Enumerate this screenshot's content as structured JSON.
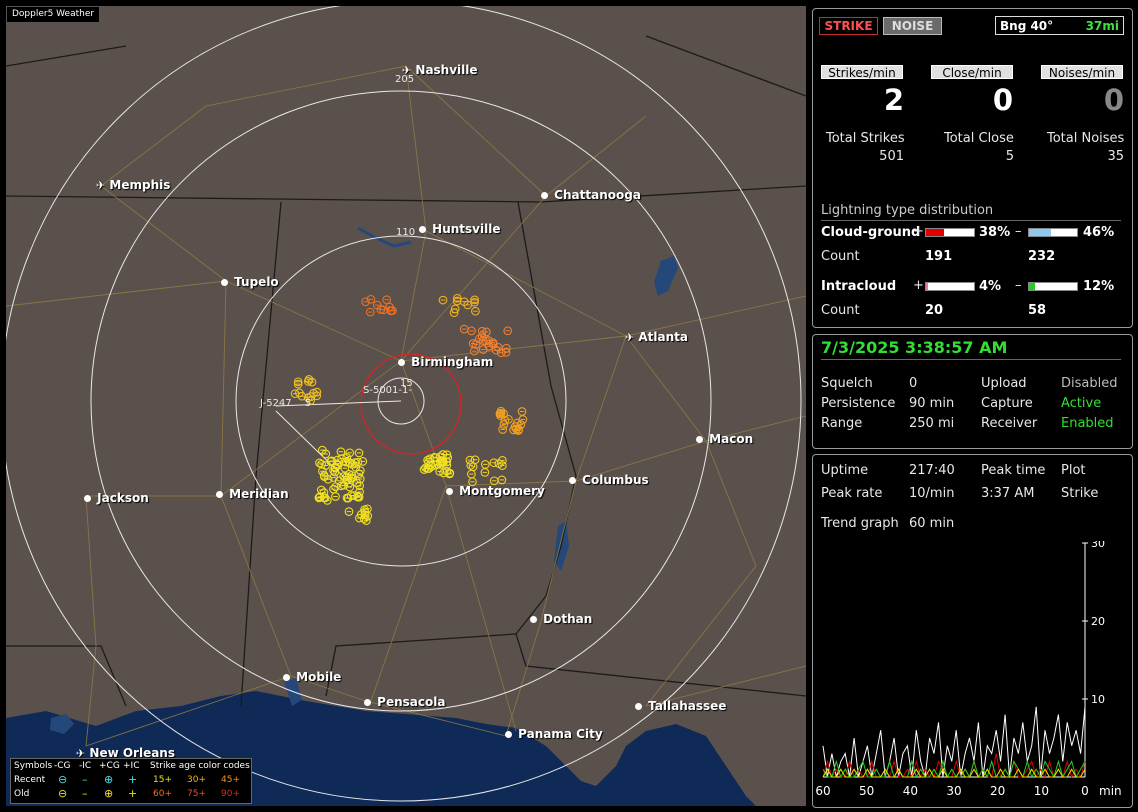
{
  "app_title": "Doppler5 Weather",
  "map": {
    "cities": [
      {
        "name": "Nashville",
        "kind": "airport"
      },
      {
        "name": "Memphis",
        "kind": "airport"
      },
      {
        "name": "Chattanooga",
        "kind": "dot"
      },
      {
        "name": "Huntsville",
        "kind": "dot"
      },
      {
        "name": "Tupelo",
        "kind": "dot"
      },
      {
        "name": "Atlanta",
        "kind": "airport"
      },
      {
        "name": "Birmingham",
        "kind": "dot"
      },
      {
        "name": "Macon",
        "kind": "dot"
      },
      {
        "name": "Columbus",
        "kind": "dot"
      },
      {
        "name": "Jackson",
        "kind": "dot"
      },
      {
        "name": "Meridian",
        "kind": "dot"
      },
      {
        "name": "Montgomery",
        "kind": "dot"
      },
      {
        "name": "Dothan",
        "kind": "dot"
      },
      {
        "name": "Mobile",
        "kind": "dot"
      },
      {
        "name": "Pensacola",
        "kind": "dot"
      },
      {
        "name": "Tallahassee",
        "kind": "dot"
      },
      {
        "name": "Panama City",
        "kind": "dot"
      },
      {
        "name": "New Orleans",
        "kind": "airport"
      }
    ],
    "range_labels": {
      "r205": "205",
      "r110": "110",
      "r15": "15",
      "r5": "5"
    },
    "cursor_labels": {
      "storm": "S-5001-1-",
      "track": "J-5247"
    }
  },
  "legend": {
    "header": {
      "symbols": "Symbols",
      "ncg": "-CG",
      "nic": "-IC",
      "pcg": "+CG",
      "pic": "+IC",
      "age": "Strike age color codes"
    },
    "recent": {
      "label": "Recent",
      "a": "15+",
      "b": "30+",
      "c": "45+"
    },
    "old": {
      "label": "Old",
      "a": "60+",
      "b": "75+",
      "c": "90+"
    }
  },
  "status": {
    "strike_button": "STRIKE",
    "noise_button": "NOISE",
    "bearing_label": "Bng 40°",
    "bearing_distance": "37mi"
  },
  "rates": {
    "strikes_label": "Strikes/min",
    "close_label": "Close/min",
    "noises_label": "Noises/min",
    "strikes_value": "2",
    "close_value": "0",
    "noises_value": "0"
  },
  "totals": {
    "strikes_label": "Total Strikes",
    "close_label": "Total Close",
    "noises_label": "Total Noises",
    "strikes_value": "501",
    "close_value": "5",
    "noises_value": "35"
  },
  "distribution": {
    "title": "Lightning type distribution",
    "cg_label": "Cloud-ground",
    "ic_label": "Intracloud",
    "count_label": "Count",
    "plus": "+",
    "minus": "–",
    "cg_pos_pct": 38,
    "cg_pos_text": "38%",
    "cg_neg_pct": 46,
    "cg_neg_text": "46%",
    "ic_pos_pct": 4,
    "ic_pos_text": "4%",
    "ic_neg_pct": 12,
    "ic_neg_text": "12%",
    "cg_pos_count": "191",
    "cg_neg_count": "232",
    "ic_pos_count": "20",
    "ic_neg_count": "58",
    "colors": {
      "cg_pos": "#e00000",
      "cg_neg": "#8ec8f0",
      "ic_pos": "#f070b0",
      "ic_neg": "#20d020"
    }
  },
  "settings": {
    "datetime": "7/3/2025 3:38:57 AM",
    "squelch_label": "Squelch",
    "squelch_value": "0",
    "persistence_label": "Persistence",
    "persistence_value": "90 min",
    "range_label": "Range",
    "range_value": "250 mi",
    "upload_label": "Upload",
    "upload_value": "Disabled",
    "capture_label": "Capture",
    "capture_value": "Active",
    "receiver_label": "Receiver",
    "receiver_value": "Enabled"
  },
  "stats": {
    "uptime_label": "Uptime",
    "uptime_value": "217:40",
    "peak_time_label": "Peak time",
    "peak_time_value": "3:37 AM",
    "plot_label": "Plot",
    "plot_value": "Strike",
    "peak_rate_label": "Peak rate",
    "peak_rate_value": "10/min",
    "trend_label": "Trend graph",
    "trend_value": "60 min"
  },
  "chart_data": {
    "type": "line",
    "title": "",
    "xlabel": "min",
    "ylabel": "",
    "x_ticks": [
      "60",
      "50",
      "40",
      "30",
      "20",
      "10",
      "0"
    ],
    "y_ticks": [
      "30",
      "20",
      "10"
    ],
    "xlim": [
      60,
      0
    ],
    "ylim": [
      0,
      30
    ],
    "series": [
      {
        "color": "#ffffff",
        "values": [
          4,
          0,
          3,
          0,
          2,
          3,
          0,
          5,
          0,
          2,
          4,
          0,
          3,
          6,
          0,
          2,
          5,
          0,
          3,
          4,
          0,
          6,
          2,
          0,
          5,
          3,
          7,
          0,
          4,
          2,
          6,
          0,
          3,
          5,
          2,
          7,
          0,
          4,
          3,
          6,
          2,
          8,
          0,
          5,
          3,
          7,
          2,
          4,
          9,
          0,
          6,
          3,
          5,
          8,
          2,
          7,
          4,
          6,
          3,
          9
        ]
      },
      {
        "color": "#e00000",
        "values": [
          0,
          2,
          0,
          1,
          0,
          0,
          2,
          0,
          1,
          0,
          0,
          2,
          0,
          0,
          1,
          0,
          2,
          0,
          0,
          1,
          0,
          2,
          0,
          1,
          0,
          0,
          2,
          1,
          0,
          0,
          2,
          0,
          1,
          0,
          2,
          0,
          1,
          0,
          0,
          3,
          0,
          1,
          0,
          2,
          0,
          0,
          1,
          2,
          0,
          1,
          0,
          2,
          0,
          1,
          0,
          2,
          0,
          1,
          0,
          2
        ]
      },
      {
        "color": "#20d020",
        "values": [
          1,
          0,
          0,
          2,
          0,
          1,
          0,
          0,
          1,
          2,
          0,
          0,
          1,
          0,
          0,
          2,
          0,
          1,
          0,
          0,
          2,
          0,
          1,
          0,
          0,
          1,
          0,
          2,
          0,
          1,
          0,
          0,
          1,
          0,
          2,
          0,
          1,
          0,
          2,
          0,
          0,
          1,
          0,
          2,
          1,
          0,
          2,
          0,
          1,
          0,
          2,
          1,
          0,
          2,
          0,
          1,
          2,
          0,
          1,
          2
        ]
      },
      {
        "color": "#f0e000",
        "values": [
          0,
          1,
          0,
          0,
          1,
          0,
          0,
          1,
          0,
          0,
          1,
          0,
          0,
          0,
          1,
          0,
          0,
          1,
          0,
          0,
          0,
          1,
          0,
          0,
          1,
          0,
          0,
          1,
          0,
          0,
          0,
          1,
          0,
          0,
          1,
          0,
          0,
          1,
          0,
          0,
          1,
          0,
          0,
          0,
          1,
          0,
          0,
          1,
          0,
          0,
          1,
          0,
          0,
          1,
          0,
          0,
          1,
          0,
          0,
          1
        ]
      }
    ]
  }
}
